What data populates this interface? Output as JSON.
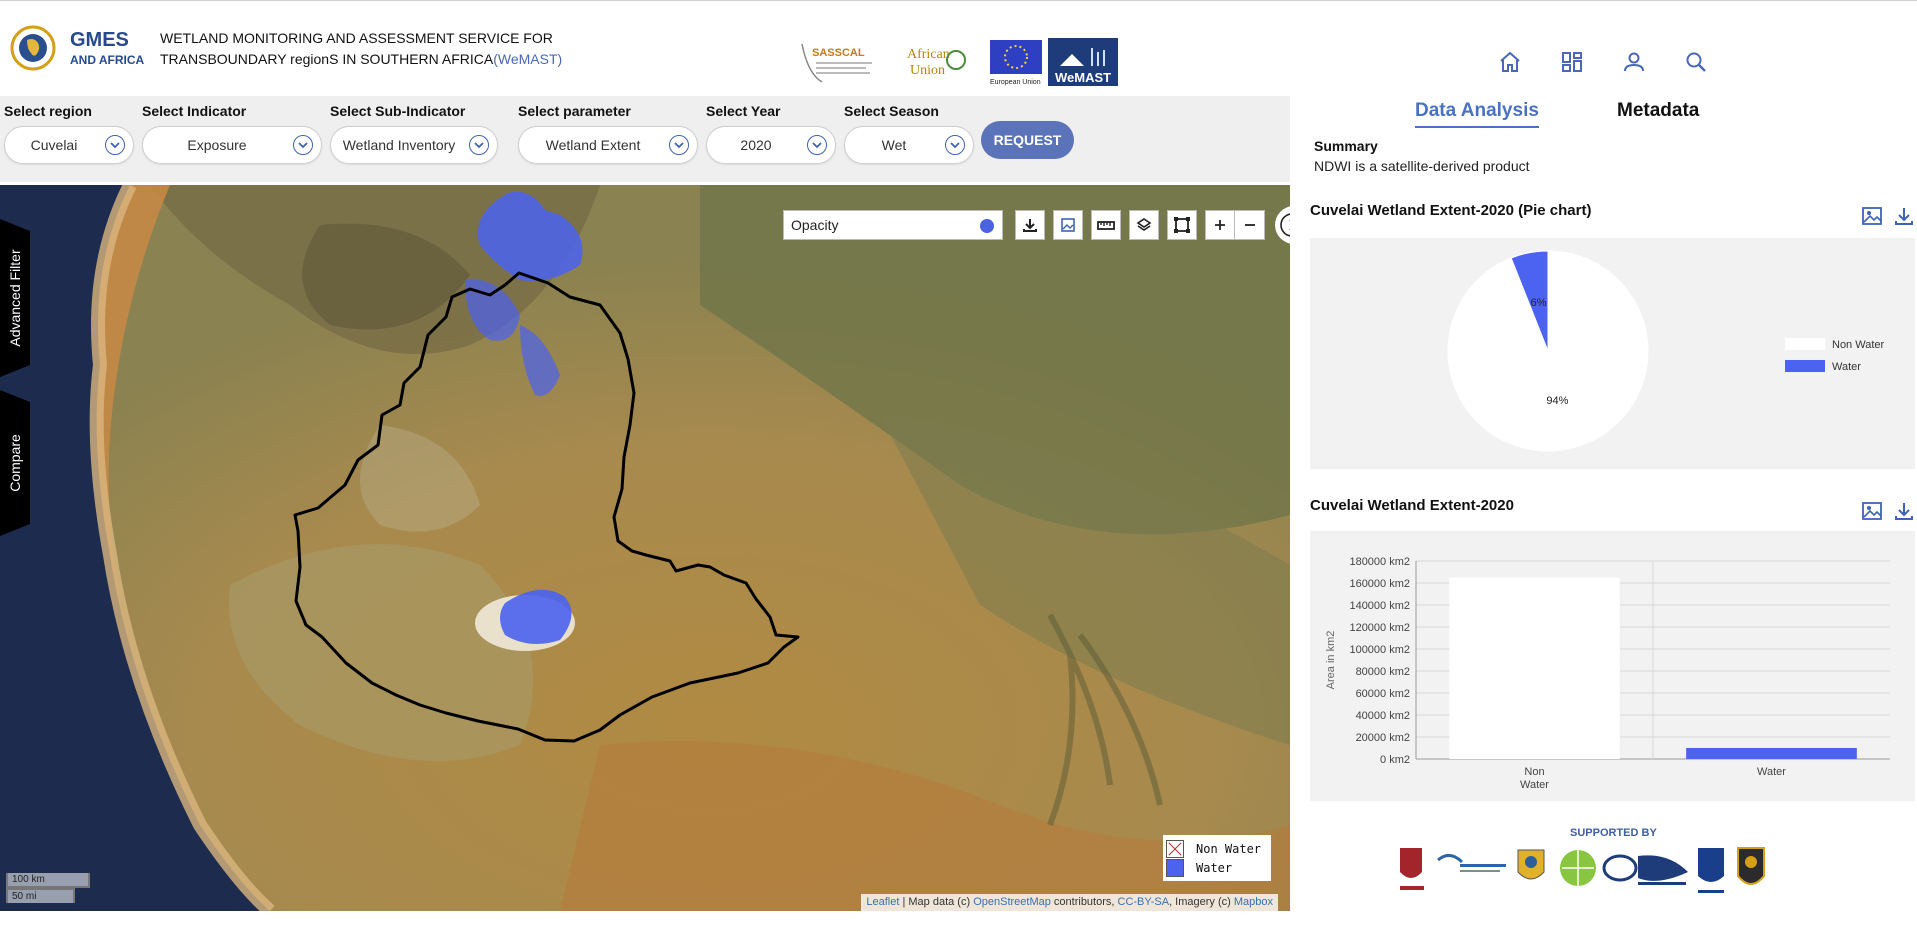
{
  "header": {
    "title_line1": "WETLAND MONITORING AND ASSESSMENT SERVICE FOR",
    "title_line2": "TRANSBOUNDARY regionS IN SOUTHERN AFRICA",
    "title_acronym": "(WeMAST)",
    "logo_text_gmes": "GMES",
    "logo_text_africa": "AND AFRICA",
    "partner_sasscal": "SASSCAL",
    "partner_au_1": "African",
    "partner_au_2": "Union",
    "partner_eu": "European Union",
    "partner_wemast": "WeMAST",
    "nav_icons": [
      "home-icon",
      "dashboard-icon",
      "user-icon",
      "search-icon"
    ]
  },
  "filters": {
    "region": {
      "label": "Select region",
      "value": "Cuvelai"
    },
    "indicator": {
      "label": "Select Indicator",
      "value": "Exposure"
    },
    "sub_indicator": {
      "label": "Select Sub-Indicator",
      "value": "Wetland Inventory"
    },
    "parameter": {
      "label": "Select parameter",
      "value": "Wetland Extent"
    },
    "year": {
      "label": "Select Year",
      "value": "2020"
    },
    "season": {
      "label": "Select Season",
      "value": "Wet"
    },
    "request_label": "REQUEST"
  },
  "map": {
    "side_tabs": [
      "Advanced Filter",
      "Compare"
    ],
    "opacity_label": "Opacity",
    "toolbar_icons": [
      "download-icon",
      "image-icon",
      "ruler-icon",
      "layers-icon",
      "draw-rectangle-icon",
      "zoom-in-icon",
      "zoom-out-icon"
    ],
    "legend": [
      {
        "label": "Non Water",
        "color": "#ffffff"
      },
      {
        "label": "Water",
        "color": "#4b63f0"
      }
    ],
    "scale_km": "100 km",
    "scale_mi": "50 mi",
    "attribution": {
      "leaflet": "Leaflet",
      "sep1": " | Map data (c) ",
      "osm": "OpenStreetMap",
      "sep2": " contributors, ",
      "license": "CC-BY-SA",
      "sep3": ", Imagery (c) ",
      "mapbox": "Mapbox"
    }
  },
  "panel": {
    "tabs": [
      "Data Analysis",
      "Metadata"
    ],
    "summary_title": "Summary",
    "summary_text": "NDWI is a satellite-derived product",
    "supported_by": "SUPPORTED BY"
  },
  "chart_data": [
    {
      "type": "pie",
      "title": "Cuvelai Wetland Extent-2020 (Pie chart)",
      "labels": [
        "Non Water",
        "Water"
      ],
      "values": [
        94,
        6
      ],
      "data_labels": [
        "94%",
        "6%"
      ],
      "colors": [
        "#ffffff",
        "#4b63f0"
      ],
      "legend_position": "right"
    },
    {
      "type": "bar",
      "title": "Cuvelai Wetland Extent-2020",
      "categories": [
        "Non Water",
        "Water"
      ],
      "category_display": [
        [
          "Non",
          "Water"
        ],
        [
          "Water"
        ]
      ],
      "values": [
        165000,
        10000
      ],
      "colors": [
        "#ffffff",
        "#4b63f0"
      ],
      "ylabel": "Area in  km2",
      "ylim": [
        0,
        180000
      ],
      "yticks": [
        "0 km2",
        "20000 km2",
        "40000 km2",
        "60000 km2",
        "80000 km2",
        "100000 km2",
        "120000 km2",
        "140000 km2",
        "160000 km2",
        "180000 km2"
      ],
      "grid": true
    }
  ]
}
